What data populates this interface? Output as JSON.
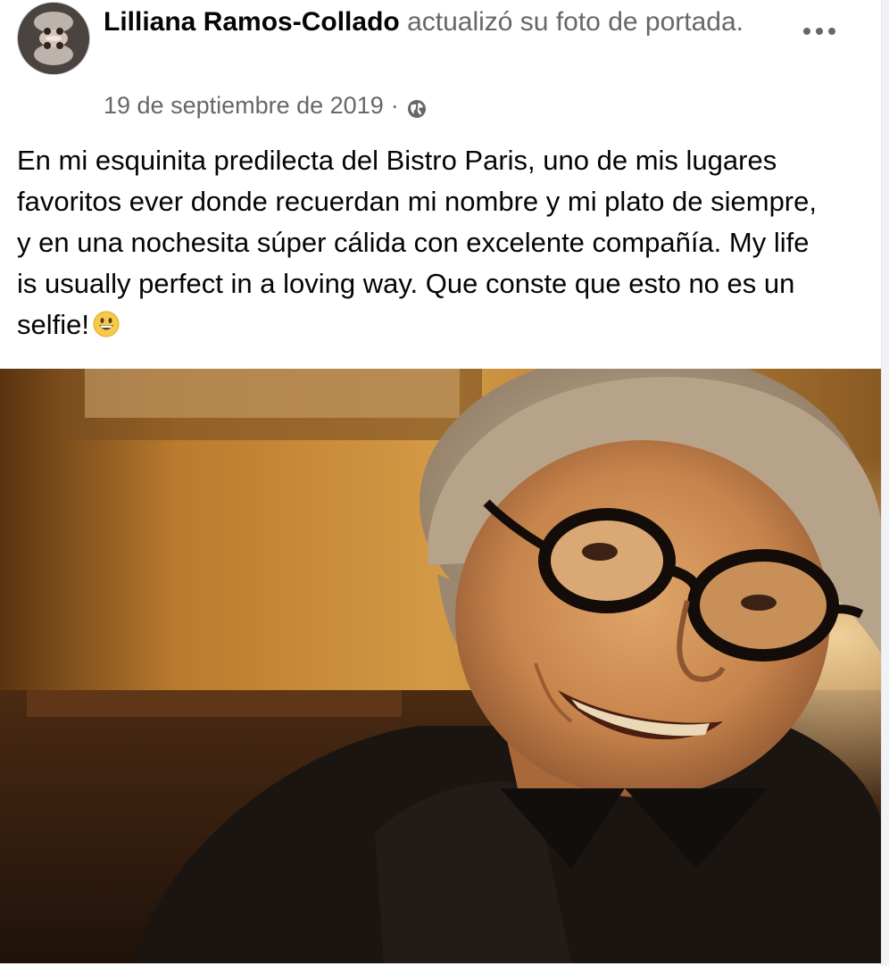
{
  "post": {
    "author": "Lilliana Ramos-Collado",
    "action": "actualizó su foto de portada.",
    "date": "19 de septiembre de 2019",
    "separator": "·",
    "privacy_icon": "globe-icon",
    "more_icon": "more-options-icon",
    "message": "En mi esquinita predilecta del Bistro Paris, uno de mis lugares favoritos ever donde recuerdan mi nombre y mi plato de siempre, y en una nochesita súper cálida con excelente compañía. My life is usually perfect in a loving way. Que conste que esto no es un selfie!",
    "emoji_icon": "grinning-face-emoji-icon"
  },
  "colors": {
    "author_text": "#050505",
    "secondary_text": "#65676b",
    "background": "#ffffff"
  }
}
